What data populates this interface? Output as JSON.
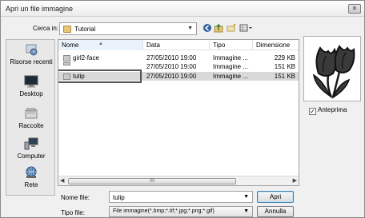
{
  "window": {
    "title": "Apri un file immagine",
    "close_glyph": "✕"
  },
  "lookin": {
    "label": "Cerca in:",
    "value": "Tutorial",
    "icon": "folder-icon"
  },
  "toolbar": {
    "icons": [
      "back-icon",
      "up-folder-icon",
      "new-folder-icon",
      "views-menu-icon"
    ]
  },
  "places": [
    {
      "label": "Risorse recenti",
      "icon": "recent-places-icon"
    },
    {
      "label": "Desktop",
      "icon": "desktop-icon"
    },
    {
      "label": "Raccolte",
      "icon": "libraries-icon"
    },
    {
      "label": "Computer",
      "icon": "computer-icon"
    },
    {
      "label": "Rete",
      "icon": "network-icon"
    }
  ],
  "columns": {
    "name": "Nome",
    "date": "Data",
    "type": "Tipo",
    "size": "Dimensione"
  },
  "files": [
    {
      "name": "girl2-face",
      "date": "27/05/2010 19:00",
      "type": "Immagine ...",
      "size": "229 KB"
    },
    {
      "name": "",
      "date": "27/05/2010 19:00",
      "type": "Immagine ...",
      "size": "151 KB"
    },
    {
      "name": "tulip",
      "date": "27/05/2010 19:00",
      "type": "Immagine ...",
      "size": "151 KB"
    }
  ],
  "scroll_thumb_glyph": "III",
  "preview_option": {
    "label": "Anteprima",
    "checked": true
  },
  "filename": {
    "label": "Nome file:",
    "value": "tulip"
  },
  "filetype": {
    "label": "Tipo file:",
    "value": "File immagine(*.bmp;*.tif;*.jpg;*.png;*.gif)"
  },
  "buttons": {
    "open": "Apri",
    "cancel": "Annulla"
  },
  "colors": {
    "selection": "#d9d9d9",
    "tulip_fill": "#3a3a3a"
  }
}
